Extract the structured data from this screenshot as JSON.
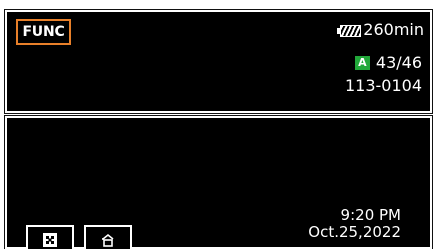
{
  "top_bar": {
    "func_label": "FUNC",
    "battery_icon": "battery-icon",
    "battery_time": "260min"
  },
  "status": {
    "card_slot": "A",
    "card_color": "#22a83a",
    "clip_count": "43/46",
    "clip_number": "113-0104"
  },
  "datetime": {
    "time": "9:20 PM",
    "date": "Oct.25,2022"
  },
  "bottom_buttons": [
    {
      "icon": "index-grid-icon"
    },
    {
      "icon": "record-mode-icon"
    }
  ],
  "colors": {
    "accent": "#e8802a",
    "background": "#000000",
    "frame": "#ffffff"
  }
}
